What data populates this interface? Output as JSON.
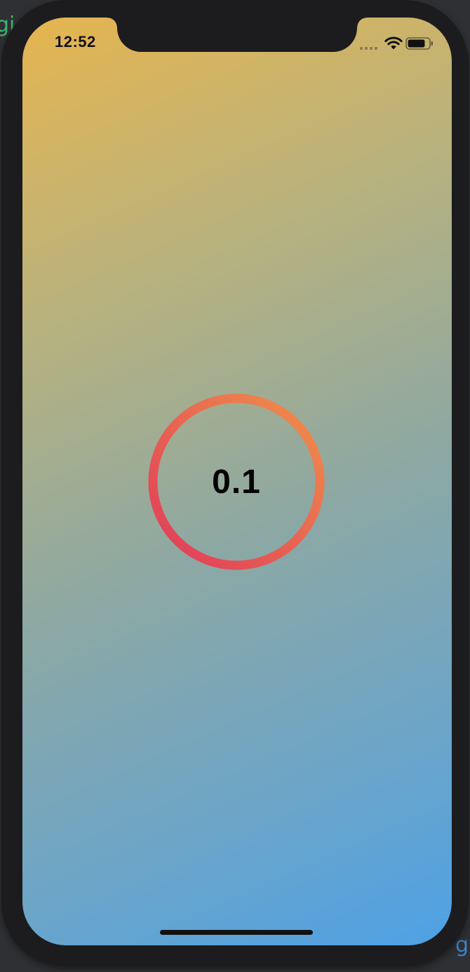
{
  "status_bar": {
    "time": "12:52",
    "icons": [
      "signal-icon",
      "wifi-icon",
      "battery-icon"
    ]
  },
  "progress_ring": {
    "value_label": "0.1",
    "progress": 1.0,
    "gradient_start": "#e0395a",
    "gradient_end": "#f0914a"
  },
  "background": {
    "gradient_top_left": "#e6b54f",
    "gradient_bottom_right": "#4ea1e6"
  },
  "backdrop_glyphs": {
    "left": "gi",
    "right": "g"
  }
}
